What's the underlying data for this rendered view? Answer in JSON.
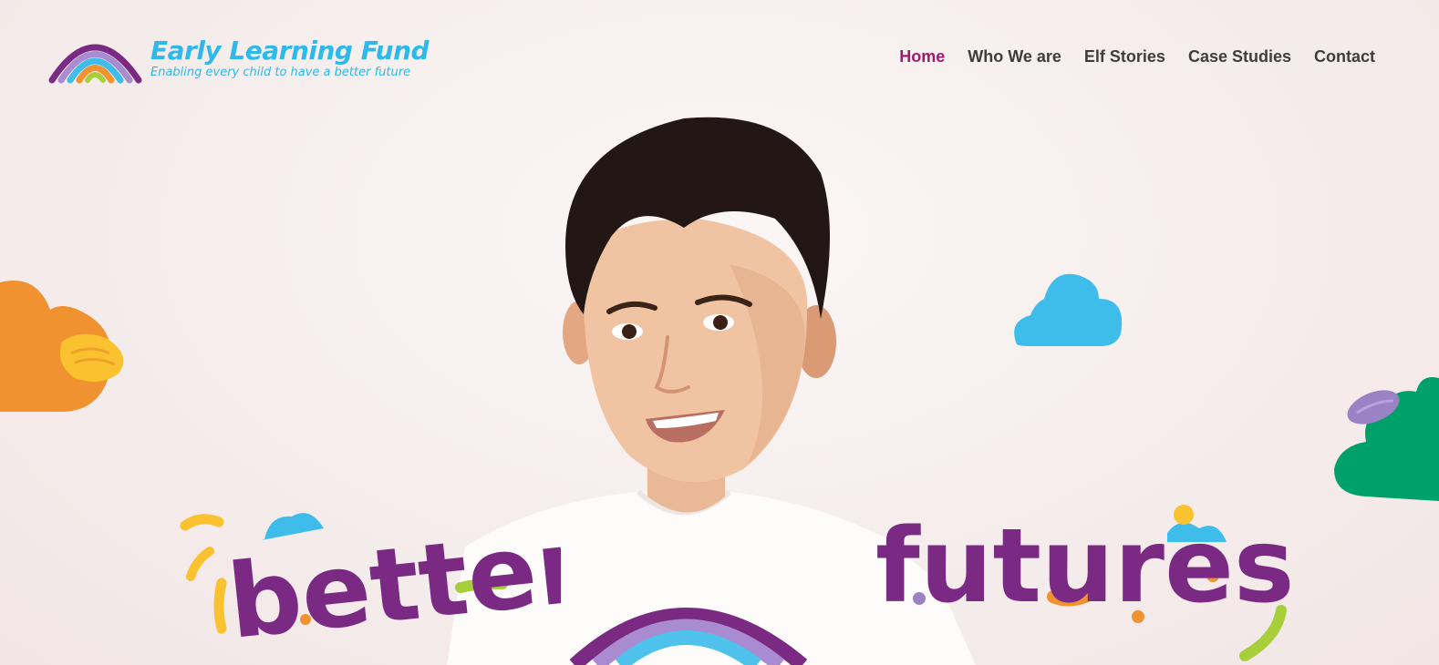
{
  "logo": {
    "title": "Early Learning Fund",
    "tagline": "Enabling every child to have a better future",
    "icon": "rainbow-icon"
  },
  "nav": {
    "items": [
      {
        "label": "Home",
        "active": true
      },
      {
        "label": "Who We are",
        "active": false
      },
      {
        "label": "Elf Stories",
        "active": false
      },
      {
        "label": "Case Studies",
        "active": false
      },
      {
        "label": "Contact",
        "active": false
      }
    ]
  },
  "hero": {
    "headline_left": "better",
    "headline_right": "futures",
    "colors": {
      "accent_pink": "#a3196d",
      "headline_purple": "#7b2a84",
      "logo_blue": "#2fb8ea",
      "cloud_orange": "#f0922f",
      "cloud_blue": "#3ebdeb",
      "cloud_green": "#00a06b",
      "confetti_yellow": "#f9c22e",
      "confetti_green": "#a6cf3a"
    }
  }
}
